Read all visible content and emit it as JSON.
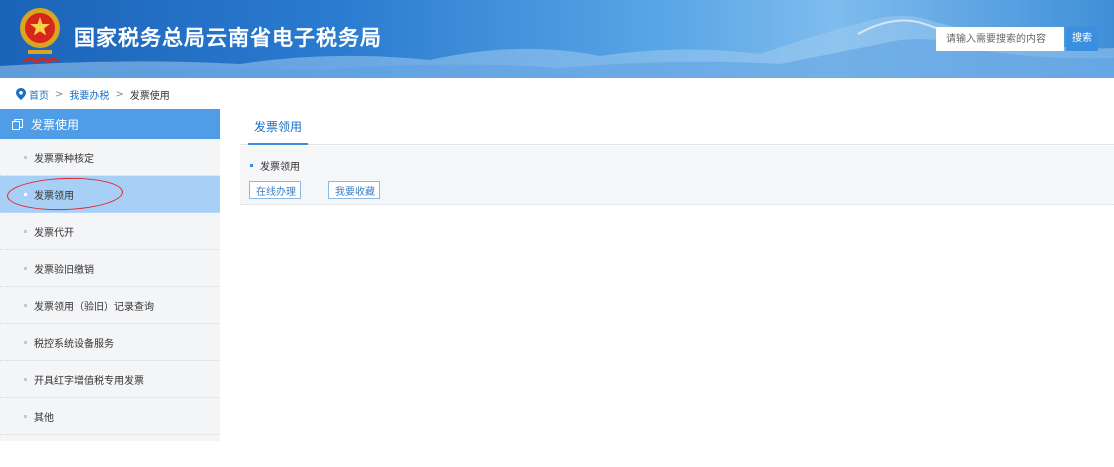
{
  "header": {
    "site_title": "国家税务总局云南省电子税务局",
    "search_placeholder": "请输入需要搜索的内容",
    "search_button": "搜索"
  },
  "breadcrumb": {
    "items": [
      "首页",
      "我要办税"
    ],
    "separator": ">",
    "current": "发票使用"
  },
  "sidebar": {
    "title": "发票使用",
    "items": [
      {
        "label": "发票票种核定"
      },
      {
        "label": "发票领用",
        "active": true
      },
      {
        "label": "发票代开"
      },
      {
        "label": "发票验旧缴销"
      },
      {
        "label": "发票领用（验旧）记录查询"
      },
      {
        "label": "税控系统设备服务"
      },
      {
        "label": "开具红字增值税专用发票"
      },
      {
        "label": "其他"
      }
    ]
  },
  "main": {
    "tab_label": "发票领用",
    "panel_title": "发票领用",
    "actions": {
      "online": "在线办理",
      "favorite": "我要收藏"
    }
  },
  "colors": {
    "accent": "#3b8fe0",
    "sidebar_header": "#4f9de6",
    "active_item": "#a8d0f6",
    "annotation": "#e0262a"
  },
  "icons": [
    "tax-emblem-icon",
    "location-pin-icon",
    "copy-icon",
    "edit-icon",
    "star-icon"
  ]
}
